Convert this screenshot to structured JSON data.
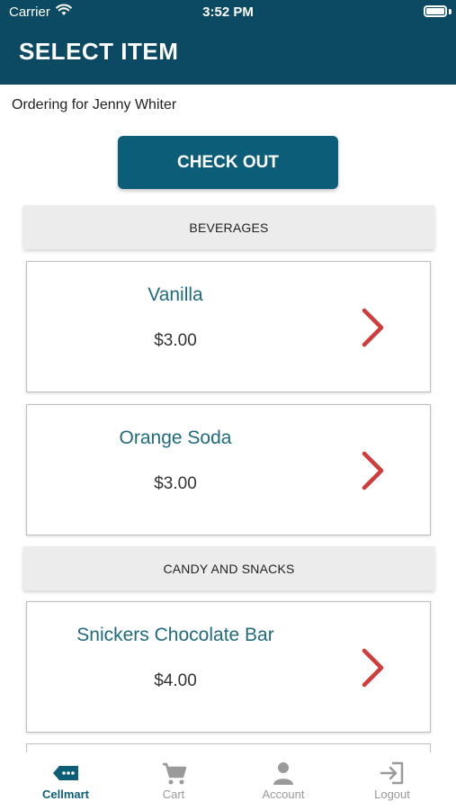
{
  "status_bar": {
    "carrier": "Carrier",
    "time": "3:52 PM"
  },
  "header": {
    "title": "SELECT ITEM"
  },
  "ordering_for": "Ordering for Jenny Whiter",
  "checkout_label": "CHECK OUT",
  "sections": [
    {
      "title": "BEVERAGES",
      "items": [
        {
          "name": "Vanilla",
          "price": "$3.00"
        },
        {
          "name": "Orange Soda",
          "price": "$3.00"
        }
      ]
    },
    {
      "title": "CANDY AND SNACKS",
      "items": [
        {
          "name": "Snickers Chocolate Bar",
          "price": "$4.00"
        }
      ]
    }
  ],
  "tabs": [
    {
      "label": "Cellmart",
      "icon": "store-tag-icon",
      "active": true
    },
    {
      "label": "Cart",
      "icon": "cart-icon",
      "active": false
    },
    {
      "label": "Account",
      "icon": "account-icon",
      "active": false
    },
    {
      "label": "Logout",
      "icon": "logout-icon",
      "active": false
    }
  ],
  "colors": {
    "header_bg": "#0c4a63",
    "button_bg": "#0c5d78",
    "item_name": "#1f6b7c",
    "chevron": "#d33a3a",
    "tab_inactive": "#9a9a9a"
  }
}
